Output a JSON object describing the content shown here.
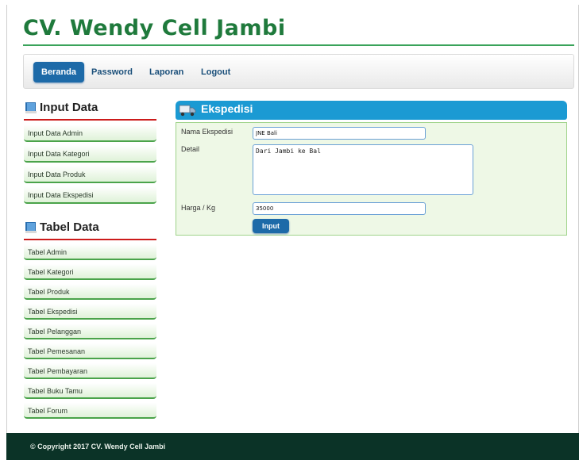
{
  "header": {
    "site_title": "CV. Wendy Cell Jambi"
  },
  "nav": {
    "items": [
      {
        "label": "Beranda",
        "active": true
      },
      {
        "label": "Password"
      },
      {
        "label": "Laporan"
      },
      {
        "label": "Logout"
      }
    ]
  },
  "sidebar": {
    "input_heading": "Input Data",
    "input_items": [
      "Input Data Admin",
      "Input Data Kategori",
      "Input Data Produk",
      "Input Data Ekspedisi"
    ],
    "table_heading": "Tabel Data",
    "table_items": [
      "Tabel Admin",
      "Tabel Kategori",
      "Tabel Produk",
      "Tabel Ekspedisi",
      "Tabel Pelanggan",
      "Tabel Pemesanan",
      "Tabel Pembayaran",
      "Tabel Buku Tamu",
      "Tabel Forum"
    ]
  },
  "panel": {
    "title": "Ekspedisi"
  },
  "form": {
    "nama_label": "Nama Ekspedisi",
    "nama_value": "JNE Bali",
    "detail_label": "Detail",
    "detail_value": "Dari Jambi ke Bal",
    "harga_label": "Harga / Kg",
    "harga_value": "35000",
    "submit_label": "Input"
  },
  "footer": {
    "copyright": "© Copyright 2017 CV. Wendy Cell Jambi"
  },
  "colors": {
    "brand_green": "#1f7a3c",
    "nav_blue": "#1d6aa8",
    "panel_blue": "#1b9ad3",
    "footer_bg": "#0b3327",
    "accent_red": "#cc1b1b"
  }
}
